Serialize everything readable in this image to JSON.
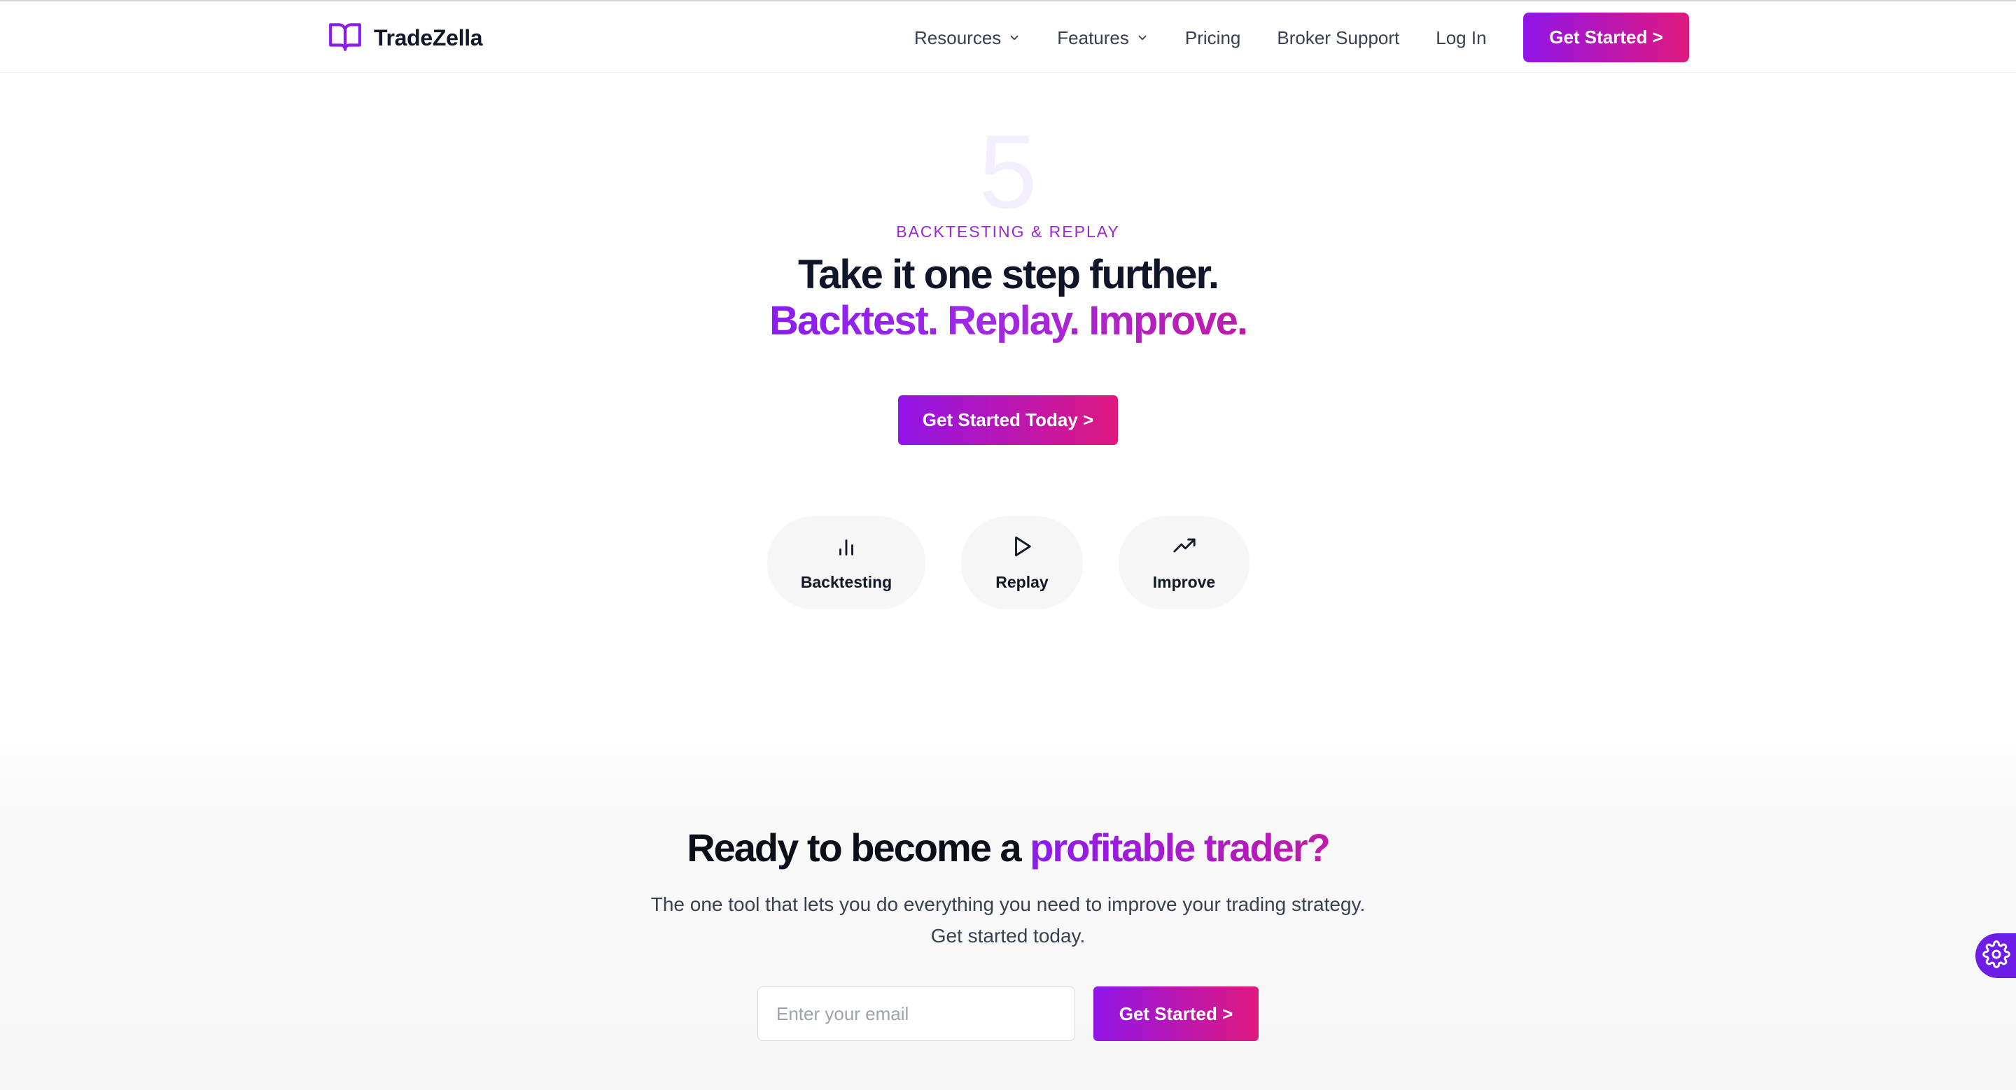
{
  "brand": {
    "name": "TradeZella",
    "logo_icon": "book-open-icon",
    "accent_color": "#8b1cf0"
  },
  "nav": {
    "items": [
      {
        "label": "Resources",
        "has_dropdown": true
      },
      {
        "label": "Features",
        "has_dropdown": true
      },
      {
        "label": "Pricing",
        "has_dropdown": false
      },
      {
        "label": "Broker Support",
        "has_dropdown": false
      },
      {
        "label": "Log In",
        "has_dropdown": false
      }
    ],
    "cta_label": "Get Started >"
  },
  "hero": {
    "step_number": "5",
    "eyebrow": "BACKTESTING & REPLAY",
    "title": "Take it one step further.",
    "subtitle": "Backtest. Replay. Improve.",
    "cta_label": "Get Started Today >",
    "features": [
      {
        "label": "Backtesting",
        "icon": "bar-chart-icon"
      },
      {
        "label": "Replay",
        "icon": "play-icon"
      },
      {
        "label": "Improve",
        "icon": "trending-up-icon"
      }
    ]
  },
  "signup": {
    "title_prefix": "Ready to become a ",
    "title_accent": "profitable trader?",
    "description_line1": "The one tool that lets you do everything you need to improve your trading strategy.",
    "description_line2": "Get started today.",
    "email_placeholder": "Enter your email",
    "email_value": "",
    "cta_label": "Get Started >"
  },
  "floating_widget": {
    "icon": "gear-icon"
  },
  "colors": {
    "gradient_start": "#9115e8",
    "gradient_end": "#e0187f",
    "eyebrow": "#9b27d6",
    "widget": "#6d1de6"
  }
}
